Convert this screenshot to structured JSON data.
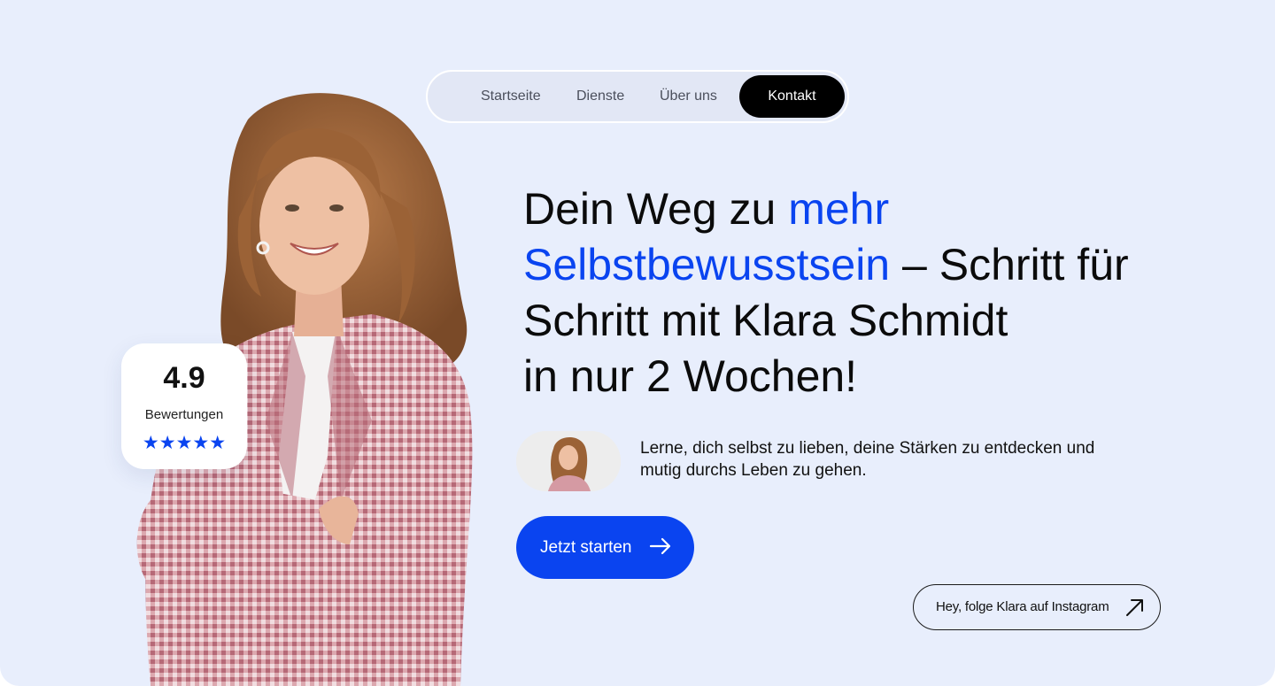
{
  "nav": {
    "items": [
      {
        "label": "Startseite"
      },
      {
        "label": "Dienste"
      },
      {
        "label": "Über uns"
      }
    ],
    "cta_label": "Kontakt"
  },
  "rating": {
    "value": "4.9",
    "label": "Bewertungen",
    "stars": "★★★★★",
    "star_count": 5
  },
  "hero": {
    "headline_part1": "Dein Weg zu ",
    "headline_accent": "mehr Selbstbewusstsein",
    "headline_part2": " – Schritt für Schritt mit Klara Schmidt",
    "headline_line4": "in nur 2 Wochen!",
    "subtext": "Lerne, dich selbst zu lieben, deine Stärken zu entdecken und mutig durchs Leben zu gehen.",
    "cta_label": "Jetzt starten"
  },
  "instagram": {
    "label": "Hey, folge Klara auf Instagram"
  },
  "colors": {
    "background": "#e8eefc",
    "accent": "#0a44f0",
    "nav_active": "#000000"
  },
  "icons": {
    "cta": "arrow-right-icon",
    "instagram": "arrow-up-right-icon",
    "rating": "star-icon"
  }
}
